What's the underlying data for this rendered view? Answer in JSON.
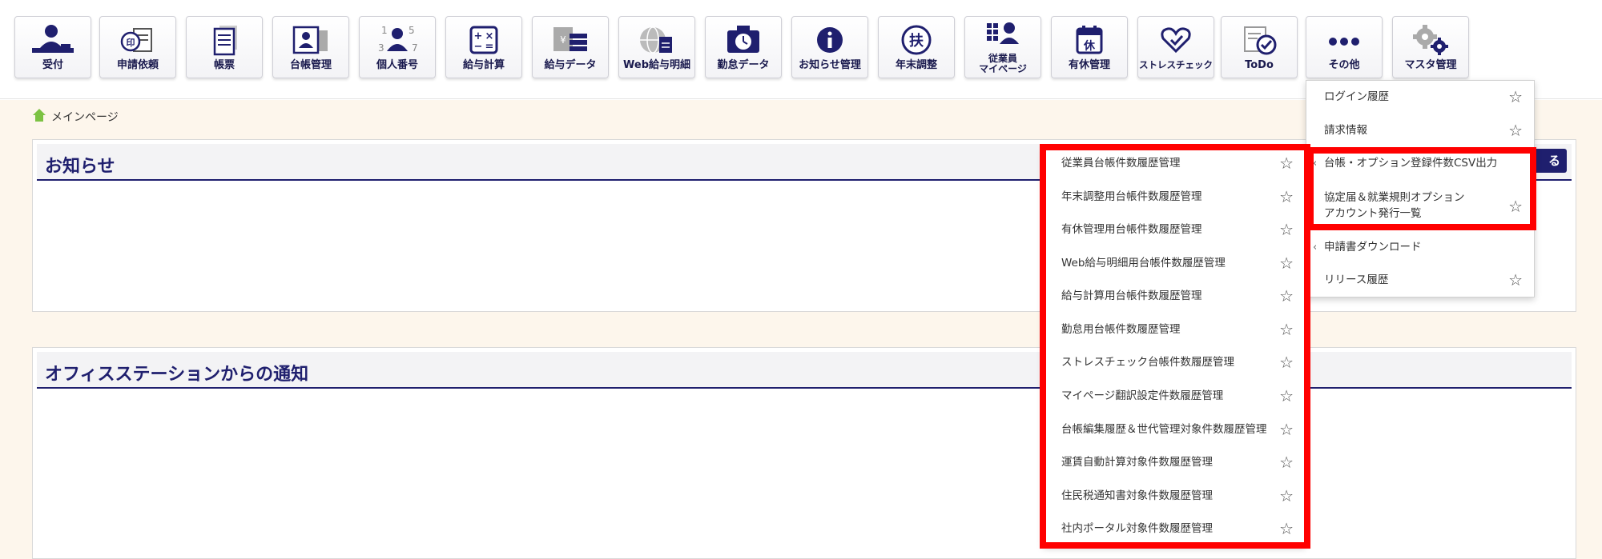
{
  "toolbar": {
    "items": [
      {
        "label": "受付",
        "icon": "reception-icon"
      },
      {
        "label": "申請依頼",
        "icon": "stamp-request-icon"
      },
      {
        "label": "帳票",
        "icon": "document-icon"
      },
      {
        "label": "台帳管理",
        "icon": "ledger-icon"
      },
      {
        "label": "個人番号",
        "icon": "personal-number-icon"
      },
      {
        "label": "給与計算",
        "icon": "calculator-icon"
      },
      {
        "label": "給与データ",
        "icon": "salary-data-icon"
      },
      {
        "label": "Web給与明細",
        "icon": "web-payslip-icon"
      },
      {
        "label": "勤怠データ",
        "icon": "attendance-icon"
      },
      {
        "label": "お知らせ管理",
        "icon": "info-icon"
      },
      {
        "label": "年末調整",
        "icon": "year-end-adjustment-icon"
      },
      {
        "label": "従業員\nマイページ",
        "icon": "employee-mypage-icon"
      },
      {
        "label": "有休管理",
        "icon": "paid-leave-calendar-icon"
      },
      {
        "label": "ストレスチェック",
        "icon": "heart-check-icon"
      },
      {
        "label": "ToDo",
        "icon": "todo-check-icon"
      },
      {
        "label": "その他",
        "icon": "more-dots-icon"
      },
      {
        "label": "マスタ管理",
        "icon": "gear-icon"
      }
    ]
  },
  "breadcrumb": {
    "label": "メインページ"
  },
  "panels": {
    "notice_title": "お知らせ",
    "office_title": "オフィスステーションからの通知",
    "more_label": "る"
  },
  "dropdown": {
    "items": [
      {
        "label": "ログイン履歴",
        "star": "☆"
      },
      {
        "label": "請求情報",
        "star": "☆"
      },
      {
        "label": "台帳・オプション登録件数CSV出力",
        "arrow": "‹"
      },
      {
        "label": "協定届＆就業規則オプション\nアカウント発行一覧",
        "star": "☆"
      },
      {
        "label": "申請書ダウンロード",
        "arrow": "‹"
      },
      {
        "label": "リリース履歴",
        "star": "☆"
      }
    ]
  },
  "submenu": {
    "items": [
      {
        "label": "従業員台帳件数履歴管理",
        "star": "☆"
      },
      {
        "label": "年末調整用台帳件数履歴管理",
        "star": "☆"
      },
      {
        "label": "有休管理用台帳件数履歴管理",
        "star": "☆"
      },
      {
        "label": "Web給与明細用台帳件数履歴管理",
        "star": "☆"
      },
      {
        "label": "給与計算用台帳件数履歴管理",
        "star": "☆"
      },
      {
        "label": "勤怠用台帳件数履歴管理",
        "star": "☆"
      },
      {
        "label": "ストレスチェック台帳件数履歴管理",
        "star": "☆"
      },
      {
        "label": "マイページ翻訳設定件数履歴管理",
        "star": "☆"
      },
      {
        "label": "台帳編集履歴＆世代管理対象件数履歴管理",
        "star": "☆"
      },
      {
        "label": "運賃自動計算対象件数履歴管理",
        "star": "☆"
      },
      {
        "label": "住民税通知書対象件数履歴管理",
        "star": "☆"
      },
      {
        "label": "社内ポータル対象件数履歴管理",
        "star": "☆"
      }
    ]
  },
  "colors": {
    "accent": "#1f1f6e",
    "highlight": "#ff0000",
    "page_bg": "#fdf6ec"
  }
}
